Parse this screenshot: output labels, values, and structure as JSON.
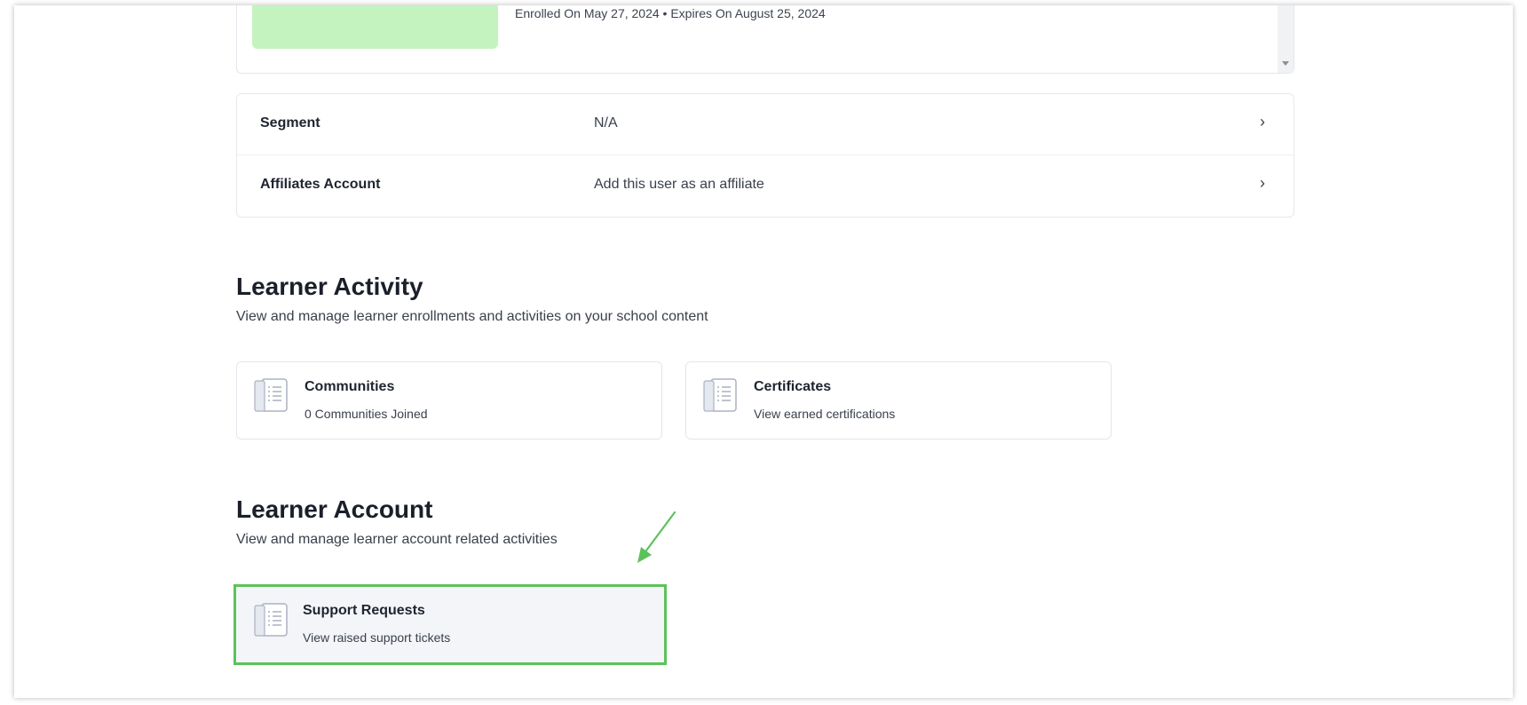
{
  "course": {
    "meta": "Enrolled On May 27, 2024 • Expires On August 25, 2024"
  },
  "info_rows": [
    {
      "label": "Segment",
      "value": "N/A",
      "chevron": "›"
    },
    {
      "label": "Affiliates Account",
      "value": "Add this user as an affiliate",
      "chevron": "›"
    }
  ],
  "learner_activity": {
    "title": "Learner Activity",
    "subtitle": "View and manage learner enrollments and activities on your school content",
    "tiles": [
      {
        "title": "Communities",
        "desc": "0 Communities Joined",
        "icon": "document-list-icon"
      },
      {
        "title": "Certificates",
        "desc": "View earned certifications",
        "icon": "document-list-icon"
      }
    ]
  },
  "learner_account": {
    "title": "Learner Account",
    "subtitle": "View and manage learner account related activities",
    "tiles": [
      {
        "title": "Support Requests",
        "desc": "View raised support tickets",
        "icon": "document-list-icon"
      }
    ]
  },
  "colors": {
    "highlight_border": "#5bc25a",
    "thumbnail": "#c4f3bf",
    "annotation_arrow": "#5bc25a"
  }
}
